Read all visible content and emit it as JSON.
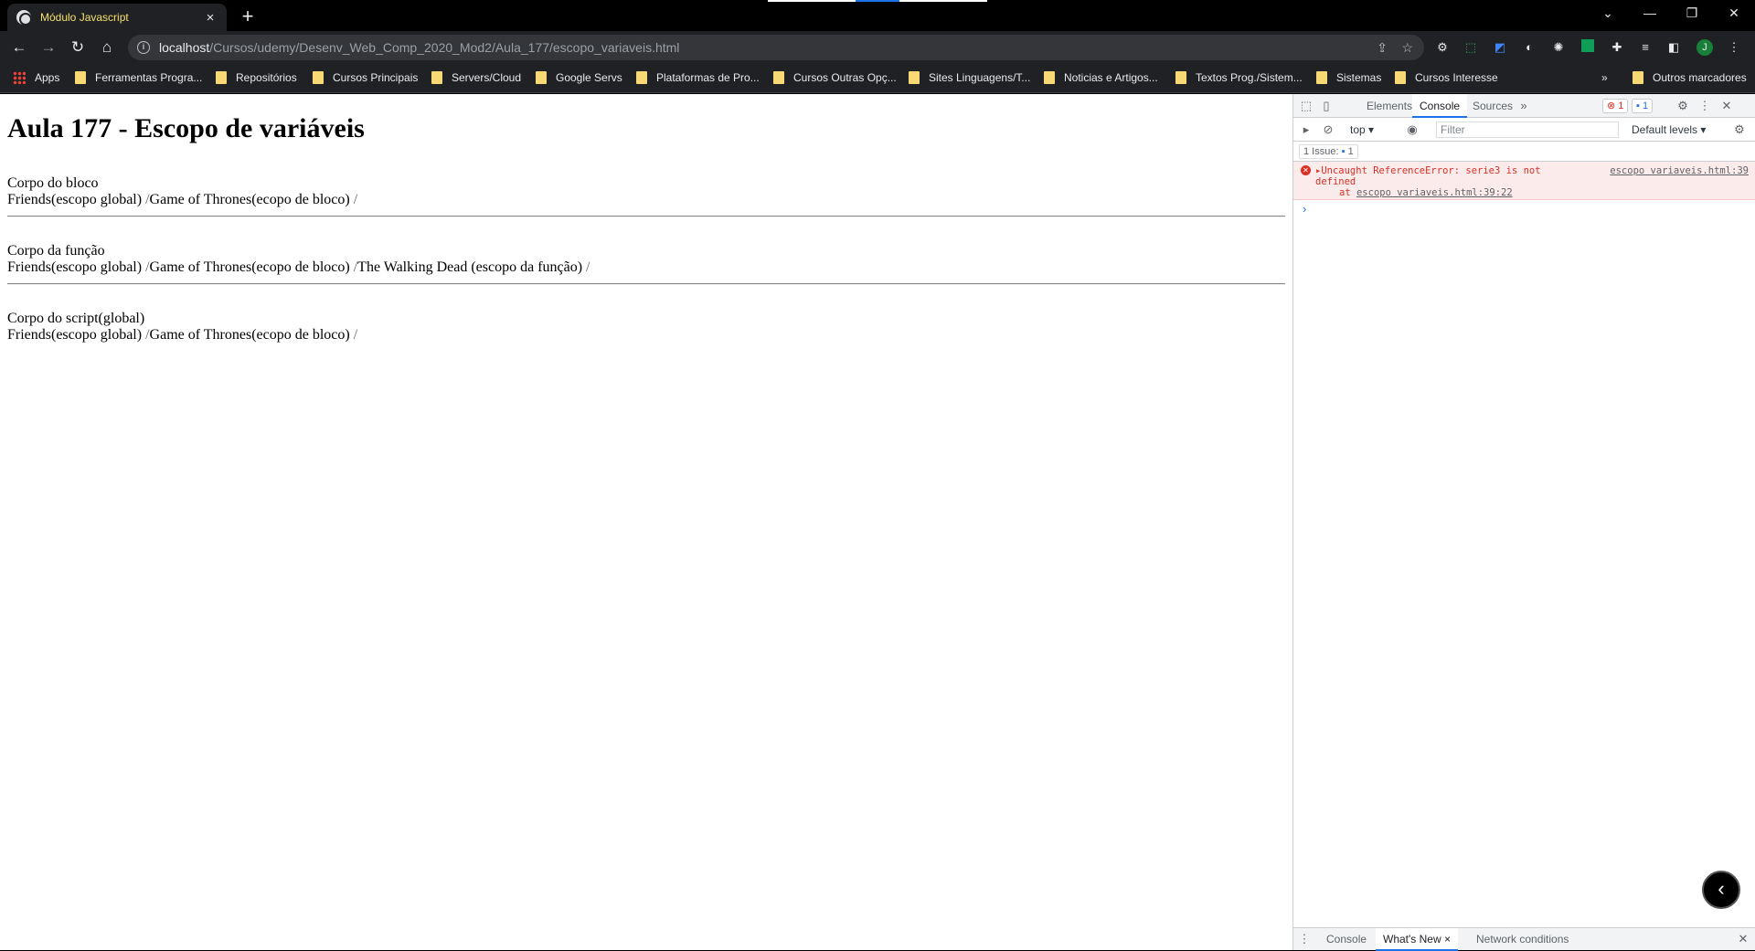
{
  "browser": {
    "tab_title": "Módulo Javascript",
    "tab_close": "×",
    "new_tab": "+",
    "url_host": "localhost",
    "url_path": "/Cursos/udemy/Desenv_Web_Comp_2020_Mod2/Aula_177/escopo_variaveis.html",
    "profile_initial": "J",
    "bookmarks": [
      "Apps",
      "Ferramentas Progra...",
      "Repositórios",
      "Cursos Principais",
      "Servers/Cloud",
      "Google Servs",
      "Plataformas de Pro...",
      "Cursos Outras Opç...",
      "Sites Linguagens/T...",
      "Noticias e Artigos...",
      "Textos Prog./Sistem...",
      "Sistemas",
      "Cursos Interesse"
    ],
    "more_bookmarks": "»",
    "other_bookmarks": "Outros marcadores"
  },
  "page": {
    "heading": "Aula 177 - Escopo de variáveis",
    "sections": [
      {
        "title": "Corpo do bloco",
        "items": [
          "Friends(escopo global)",
          "Game of Thrones(ecopo de bloco)"
        ]
      },
      {
        "title": "Corpo da função",
        "items": [
          "Friends(escopo global)",
          "Game of Thrones(ecopo de bloco)",
          "The Walking Dead (escopo da função)"
        ]
      },
      {
        "title": "Corpo do script(global)",
        "items": [
          "Friends(escopo global)",
          "Game of Thrones(ecopo de bloco)"
        ]
      }
    ],
    "separator": "/"
  },
  "devtools": {
    "tabs": [
      "Elements",
      "Console",
      "Sources"
    ],
    "active_tab": "Console",
    "more_tabs": "»",
    "error_count": "1",
    "message_count": "1",
    "context": "top",
    "filter_placeholder": "Filter",
    "levels": "Default levels",
    "issues_label": "1 Issue:",
    "issues_count": "1",
    "error": {
      "message_line1": "Uncaught ReferenceError: serie3 is not",
      "message_line2": "defined",
      "source": "escopo variaveis.html:39",
      "stack_prefix": "at",
      "stack_link": "escopo variaveis.html:39:22"
    },
    "prompt": "›",
    "drawer_tabs": [
      "Console",
      "What's New",
      "Network conditions"
    ],
    "drawer_active": "What's New",
    "drawer_close": "×"
  }
}
